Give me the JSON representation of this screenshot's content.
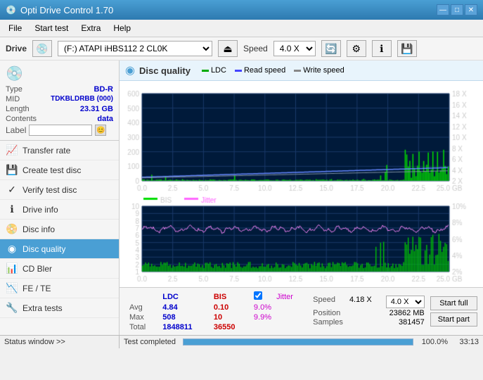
{
  "app": {
    "title": "Opti Drive Control 1.70",
    "icon": "💿"
  },
  "title_controls": {
    "minimize": "—",
    "maximize": "□",
    "close": "✕"
  },
  "menu": {
    "items": [
      "File",
      "Start test",
      "Extra",
      "Help"
    ]
  },
  "toolbar": {
    "drive_label": "Drive",
    "drive_value": "(F:) ATAPI iHBS112  2 CL0K",
    "speed_label": "Speed",
    "speed_value": "4.0 X"
  },
  "disc_info": {
    "type_label": "Type",
    "type_value": "BD-R",
    "mid_label": "MID",
    "mid_value": "TDKBLDRBB (000)",
    "length_label": "Length",
    "length_value": "23.31 GB",
    "contents_label": "Contents",
    "contents_value": "data",
    "label_label": "Label"
  },
  "sidebar_nav": [
    {
      "id": "transfer-rate",
      "label": "Transfer rate",
      "icon": "📈"
    },
    {
      "id": "create-test-disc",
      "label": "Create test disc",
      "icon": "💾"
    },
    {
      "id": "verify-test-disc",
      "label": "Verify test disc",
      "icon": "✓"
    },
    {
      "id": "drive-info",
      "label": "Drive info",
      "icon": "ℹ"
    },
    {
      "id": "disc-info",
      "label": "Disc info",
      "icon": "📀"
    },
    {
      "id": "disc-quality",
      "label": "Disc quality",
      "icon": "◉",
      "active": true
    },
    {
      "id": "cd-bler",
      "label": "CD Bler",
      "icon": "📊"
    },
    {
      "id": "fe-te",
      "label": "FE / TE",
      "icon": "📉"
    },
    {
      "id": "extra-tests",
      "label": "Extra tests",
      "icon": "🔧"
    }
  ],
  "disc_quality": {
    "title": "Disc quality",
    "legend": [
      {
        "id": "ldc",
        "label": "LDC",
        "color": "#00aa00"
      },
      {
        "id": "read-speed",
        "label": "Read speed",
        "color": "#4444ff"
      },
      {
        "id": "write-speed",
        "label": "Write speed",
        "color": "#aaaaaa"
      }
    ],
    "bis_legend": [
      {
        "id": "bis",
        "label": "BIS",
        "color": "#00aa00"
      },
      {
        "id": "jitter",
        "label": "Jitter",
        "color": "#ff00ff"
      }
    ]
  },
  "stats": {
    "headers": [
      "",
      "LDC",
      "BIS"
    ],
    "avg_label": "Avg",
    "avg_ldc": "4.84",
    "avg_bis": "0.10",
    "max_label": "Max",
    "max_ldc": "508",
    "max_bis": "10",
    "total_label": "Total",
    "total_ldc": "1848811",
    "total_bis": "36550",
    "jitter_label": "Jitter",
    "avg_jitter": "9.0%",
    "max_jitter": "9.9%",
    "speed_label": "Speed",
    "speed_value": "4.18 X",
    "speed_select": "4.0 X",
    "position_label": "Position",
    "position_value": "23862 MB",
    "samples_label": "Samples",
    "samples_value": "381457"
  },
  "buttons": {
    "start_full": "Start full",
    "start_part": "Start part"
  },
  "status_bar": {
    "status_window": "Status window >>",
    "test_completed": "Test completed",
    "progress_pct": "100.0%",
    "time": "33:13"
  },
  "chart_top": {
    "y_left_max": 600,
    "y_left_min": 0,
    "y_right_labels": [
      "18 X",
      "16 X",
      "14 X",
      "12 X",
      "10 X",
      "8 X",
      "6 X",
      "4 X",
      "2 X"
    ],
    "x_labels": [
      "0.0",
      "2.5",
      "5.0",
      "7.5",
      "10.0",
      "12.5",
      "15.0",
      "17.5",
      "20.0",
      "22.5",
      "25.0 GB"
    ]
  },
  "chart_bottom": {
    "y_left_max": 10,
    "y_left_min": 1,
    "y_right_labels": [
      "10%",
      "8%",
      "6%",
      "4%",
      "2%"
    ],
    "x_labels": [
      "0.0",
      "2.5",
      "5.0",
      "7.5",
      "10.0",
      "12.5",
      "15.0",
      "17.5",
      "20.0",
      "22.5",
      "25.0 GB"
    ]
  },
  "colors": {
    "accent": "#4a9fd4",
    "ldc_bar": "#00cc00",
    "bis_bar": "#00cc00",
    "read_speed": "#4444ff",
    "write_speed": "#aaaaaa",
    "jitter": "#ff66ff",
    "active_nav_bg": "#4a9fd4",
    "chart_bg": "#001a40",
    "chart_grid": "#003366"
  }
}
